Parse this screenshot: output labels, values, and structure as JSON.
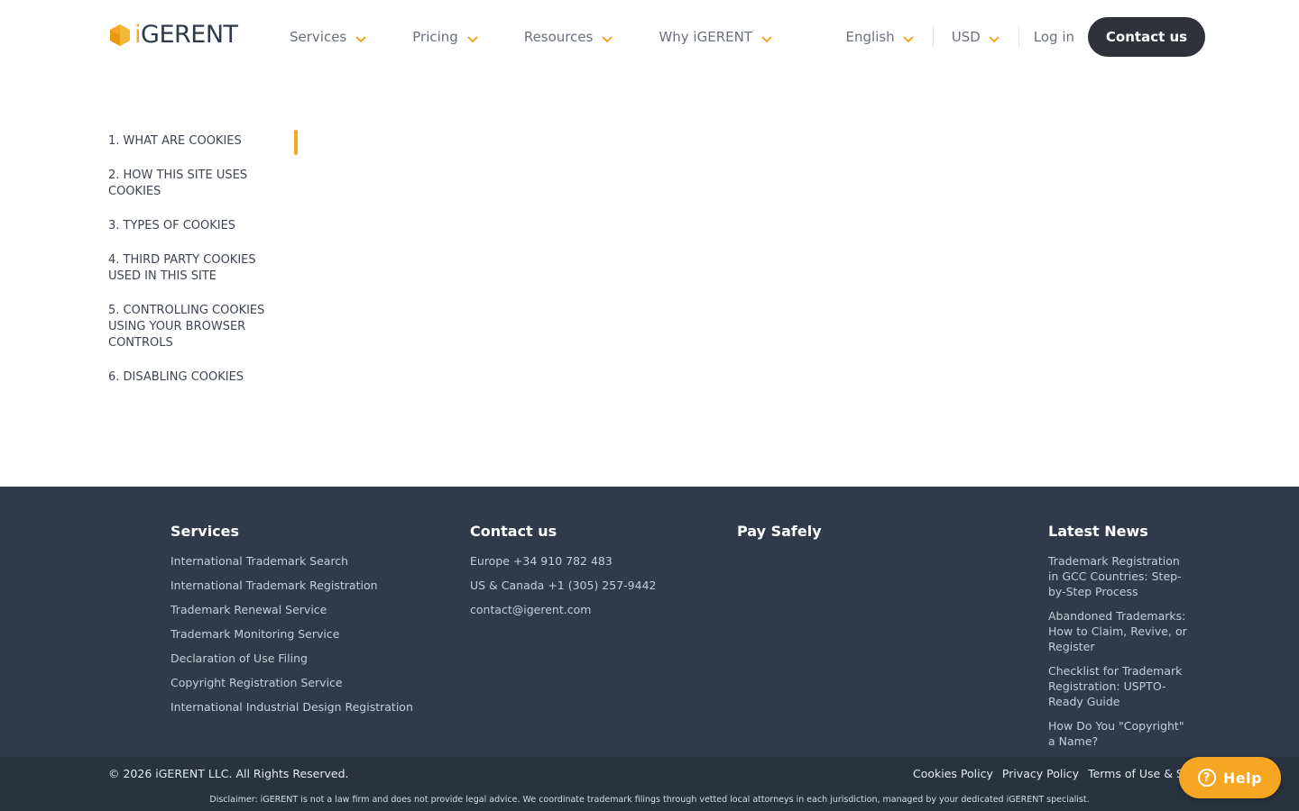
{
  "header": {
    "logo_prefix": "i",
    "logo_text": "GERENT",
    "nav": [
      {
        "label": "Services"
      },
      {
        "label": "Pricing"
      },
      {
        "label": "Resources"
      },
      {
        "label": "Why iGERENT"
      }
    ],
    "language": "English",
    "currency": "USD",
    "login_label": "Log in",
    "contact_label": "Contact us"
  },
  "toc": {
    "items": [
      {
        "label": "1. What are cookies"
      },
      {
        "label": "2. How this site uses cookies"
      },
      {
        "label": "3. Types of cookies"
      },
      {
        "label": "4. Third party cookies used in this site"
      },
      {
        "label": "5. Controlling cookies using your browser controls"
      },
      {
        "label": "6. Disabling cookies"
      }
    ]
  },
  "footer": {
    "services": {
      "title": "Services",
      "links": [
        "International Trademark Search",
        "International Trademark Registration",
        "Trademark Renewal Service",
        "Trademark Monitoring Service",
        "Declaration of Use Filing",
        "Copyright Registration Service",
        "International Industrial Design Registration"
      ]
    },
    "contact": {
      "title": "Contact us",
      "europe": "Europe +34 910 782 483",
      "us": "US & Canada +1 (305) 257-9442",
      "email": "contact@igerent.com"
    },
    "pay": {
      "title": "Pay Safely"
    },
    "news": {
      "title": "Latest News",
      "items": [
        "Trademark Registration in GCC Countries: Step-by-Step Process",
        "Abandoned Trademarks: How to Claim, Revive, or Register",
        "Checklist for Trademark Registration: USPTO-Ready Guide",
        "How Do You \"Copyright\" a Name?"
      ]
    },
    "copyright": "© 2026 iGERENT LLC. All Rights Reserved.",
    "legal": [
      "Cookies Policy",
      "Privacy Policy",
      "Terms of Use & Services"
    ],
    "disclaimer": "Disclaimer: iGERENT is not a law firm and does not provide legal advice. We coordinate trademark filings through vetted local attorneys in each jurisdiction, managed by your dedicated iGERENT specialist."
  },
  "help": {
    "label": "Help",
    "icon_glyph": "?"
  },
  "colors": {
    "accent": "#f5a623",
    "footer_bg": "#2f3a4a",
    "button_dark": "#2f3238"
  }
}
